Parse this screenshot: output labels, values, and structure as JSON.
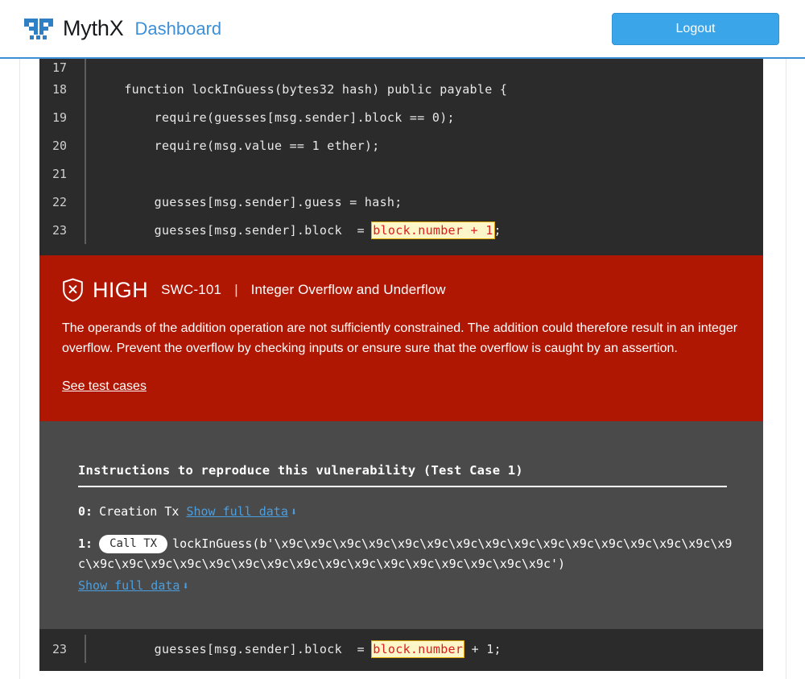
{
  "header": {
    "logo_icon": "mythx-butterfly-logo",
    "brand": "MythX",
    "section": "Dashboard",
    "logout_label": "Logout",
    "accent_color": "#3aa5e8",
    "border_color": "#3d8fd6"
  },
  "code_top": {
    "background": "#2b2b2b",
    "lines": [
      {
        "num": "17",
        "text": "",
        "highlight": null
      },
      {
        "num": "18",
        "text": "    function lockInGuess(bytes32 hash) public payable {",
        "highlight": null
      },
      {
        "num": "19",
        "text": "        require(guesses[msg.sender].block == 0);",
        "highlight": null
      },
      {
        "num": "20",
        "text": "        require(msg.value == 1 ether);",
        "highlight": null
      },
      {
        "num": "21",
        "text": "",
        "highlight": null
      },
      {
        "num": "22",
        "text": "        guesses[msg.sender].guess = hash;",
        "highlight": null
      },
      {
        "num": "23",
        "pre": "        guesses[msg.sender].block  = ",
        "highlight": "block.number + 1",
        "post": ";"
      }
    ]
  },
  "severity": {
    "background": "#b01703",
    "icon": "shield-x-icon",
    "level": "HIGH",
    "swc_id": "SWC-101",
    "separator": "|",
    "title": "Integer Overflow and Underflow",
    "description": "The operands of the addition operation are not sufficiently constrained. The addition could therefore result in an integer overflow. Prevent the overflow by checking inputs or ensure sure that the overflow is caught by an assertion.",
    "link_label": "See test cases"
  },
  "instructions": {
    "background": "#4a4a4a",
    "title": "Instructions to reproduce this vulnerability (Test Case 1)",
    "steps": [
      {
        "index": "0:",
        "label": "Creation Tx",
        "link_label": "Show full data",
        "link_icon": "download-arrow-icon"
      },
      {
        "index": "1:",
        "badge": "Call TX",
        "call": "lockInGuess(b'\\x9c\\x9c\\x9c\\x9c\\x9c\\x9c\\x9c\\x9c\\x9c\\x9c\\x9c\\x9c\\x9c\\x9c\\x9c\\x9c\\x9c\\x9c\\x9c\\x9c\\x9c\\x9c\\x9c\\x9c\\x9c\\x9c\\x9c\\x9c\\x9c\\x9c\\x9c\\x9c')",
        "link_label": "Show full data",
        "link_icon": "download-arrow-icon"
      }
    ]
  },
  "code_bottom": {
    "background": "#2b2b2b",
    "lines": [
      {
        "num": "23",
        "pre": "        guesses[msg.sender].block  = ",
        "highlight": "block.number",
        "post": " + 1;"
      }
    ]
  }
}
